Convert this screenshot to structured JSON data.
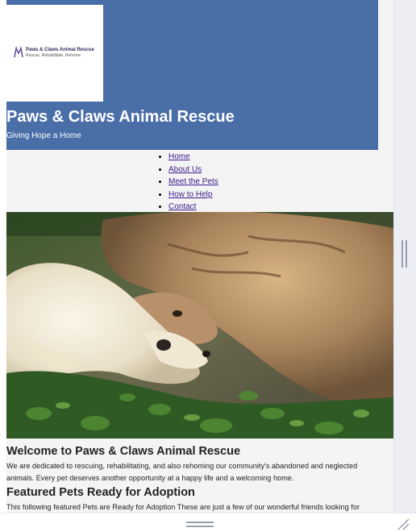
{
  "header": {
    "logo": {
      "name": "Paws & Claws Animal Rescue",
      "tagline": "Rescue. Rehabilitate. Rehome."
    },
    "title": "Paws & Claws Animal Rescue",
    "tagline": "Giving Hope a Home"
  },
  "nav": {
    "items": [
      {
        "label": "Home"
      },
      {
        "label": "About Us"
      },
      {
        "label": "Meet the Pets"
      },
      {
        "label": "How to Help"
      },
      {
        "label": "Contact"
      }
    ]
  },
  "hero": {
    "subject": "cat and dog cuddling on grass"
  },
  "welcome": {
    "heading": "Welcome to Paws & Claws Animal Rescue",
    "text": "We are dedicated to rescuing, rehabilitating, and also rehoming our community's abandoned and neglected animals. Every pet deserves another opportunity at a happy life and a welcoming home."
  },
  "featured": {
    "heading": "Featured Pets Ready for Adoption",
    "text": "This following featured Pets are Ready for Adoption These are just a few of our wonderful friends looking for"
  },
  "colors": {
    "header_bg": "#4a6ea8",
    "page_bg": "#f4f4f4",
    "link": "#3c1a8c"
  }
}
